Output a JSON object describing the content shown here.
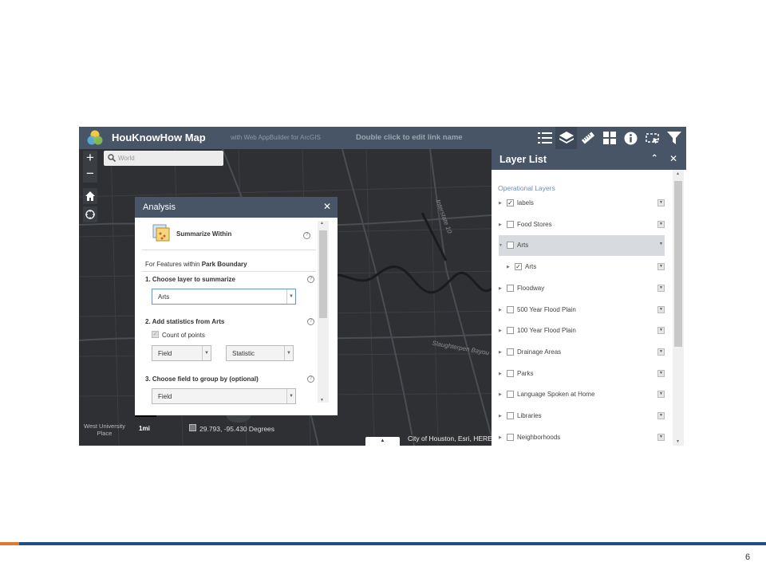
{
  "header": {
    "title": "HouKnowHow Map",
    "subtitle": "with Web AppBuilder for ArcGIS",
    "link_name": "Double click to edit link name",
    "toolbar_icons": [
      "list-icon",
      "layers-icon",
      "measure-icon",
      "grid-icon",
      "info-icon",
      "select-icon",
      "filter-icon"
    ]
  },
  "search": {
    "placeholder": "World"
  },
  "map": {
    "labels": [
      "Interstate 10",
      "Slaughterpen Bayou"
    ],
    "place_label": "West University Place",
    "scale": "1mi",
    "coordinates": "29.793, -95.430 Degrees",
    "attribution": "City of Houston, Esri, HERE"
  },
  "analysis": {
    "title": "Analysis",
    "tool_name": "Summarize Within",
    "features_prefix": "For Features within",
    "features_layer": "Park Boundary",
    "step1": "1. Choose layer to summarize",
    "step1_value": "Arts",
    "step2_prefix": "2. Add statistics from",
    "step2_layer": "Arts",
    "count_points": "Count of points",
    "field_label": "Field",
    "statistic_label": "Statistic",
    "step3": "3. Choose field to group by (optional)",
    "step3_value": "Field"
  },
  "layer_list": {
    "title": "Layer List",
    "section": "Operational Layers",
    "layers": [
      {
        "label": "labels",
        "checked": true
      },
      {
        "label": "Food Stores",
        "checked": false
      },
      {
        "label": "Arts",
        "checked": false,
        "selected": true
      },
      {
        "label": "Arts",
        "checked": true,
        "child": true
      },
      {
        "label": "Floodway",
        "checked": false
      },
      {
        "label": "500 Year Flood Plain",
        "checked": false
      },
      {
        "label": "100 Year Flood Plain",
        "checked": false
      },
      {
        "label": "Drainage Areas",
        "checked": false
      },
      {
        "label": "Parks",
        "checked": false
      },
      {
        "label": "Language Spoken at Home",
        "checked": false
      },
      {
        "label": "Libraries",
        "checked": false
      },
      {
        "label": "Neighborhoods",
        "checked": false
      }
    ]
  },
  "page_number": "6",
  "colors": {
    "header": "#485566",
    "map_bg": "#2e3033",
    "footer_bar": "#1f4f86",
    "footer_accent": "#e07830"
  }
}
